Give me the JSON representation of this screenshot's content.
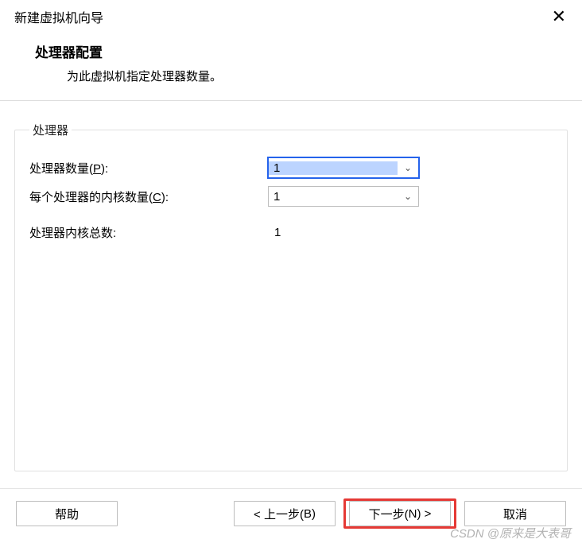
{
  "window": {
    "title": "新建虚拟机向导"
  },
  "header": {
    "title": "处理器配置",
    "subtitle": "为此虚拟机指定处理器数量。"
  },
  "group": {
    "legend": "处理器",
    "rows": {
      "proc_count": {
        "label_pre": "处理器数量(",
        "hotkey": "P",
        "label_post": "):",
        "value": "1"
      },
      "cores_per_proc": {
        "label_pre": "每个处理器的内核数量(",
        "hotkey": "C",
        "label_post": "):",
        "value": "1"
      },
      "total_cores": {
        "label": "处理器内核总数:",
        "value": "1"
      }
    }
  },
  "buttons": {
    "help": "帮助",
    "back_pre": "< 上一步(",
    "back_key": "B",
    "back_post": ")",
    "next_pre": "下一步(",
    "next_key": "N",
    "next_post": ") >",
    "cancel": "取消"
  },
  "watermark": "CSDN @原来是大表哥"
}
